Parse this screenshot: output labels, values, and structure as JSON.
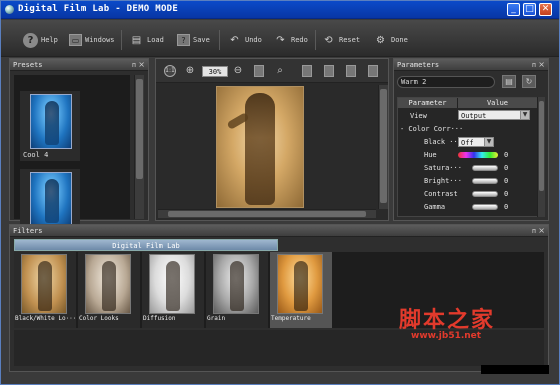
{
  "window": {
    "title": "Digital Film Lab - DEMO MODE",
    "controls": [
      "_",
      "□",
      "✕"
    ]
  },
  "toolbar": {
    "help": "Help",
    "windows": "Windows",
    "load": "Load",
    "save": "Save",
    "undo": "Undo",
    "redo": "Redo",
    "reset": "Reset",
    "done": "Done"
  },
  "presets": {
    "title": "Presets",
    "pin": "ᴨ",
    "close": "×",
    "items": [
      {
        "label": "Cool 4"
      },
      {
        "label": ""
      }
    ]
  },
  "preview": {
    "zoom": "30%",
    "fit_label": "1:1"
  },
  "parameters": {
    "title": "Parameters",
    "preset_name": "Warm 2",
    "columns": [
      "Parameter",
      "Value"
    ],
    "view_label": "View",
    "view_value": "Output",
    "group_label": "- Color Corr···",
    "rows": [
      {
        "label": "Black ···",
        "value": "Off"
      },
      {
        "label": "Hue",
        "value": "0"
      },
      {
        "label": "Satura···",
        "value": "0"
      },
      {
        "label": "Bright···",
        "value": "0"
      },
      {
        "label": "Contrast",
        "value": "0"
      },
      {
        "label": "Gamma",
        "value": "0"
      }
    ]
  },
  "filters": {
    "title": "Filters",
    "tab": "Digital Film Lab",
    "items": [
      {
        "label": "Black/White Lo···",
        "tone": "sepia"
      },
      {
        "label": "Color Looks",
        "tone": "warmgray"
      },
      {
        "label": "Diffusion",
        "tone": "light"
      },
      {
        "label": "Grain",
        "tone": "gray"
      },
      {
        "label": "Temperature",
        "tone": "orange",
        "selected": true
      }
    ]
  },
  "watermark": {
    "text": "脚本之家",
    "url": "www.jb51.net"
  },
  "colors": {
    "titlebar": "#0a4ac9",
    "panel": "#2e2e2e",
    "accent_red": "#e23a2c"
  }
}
